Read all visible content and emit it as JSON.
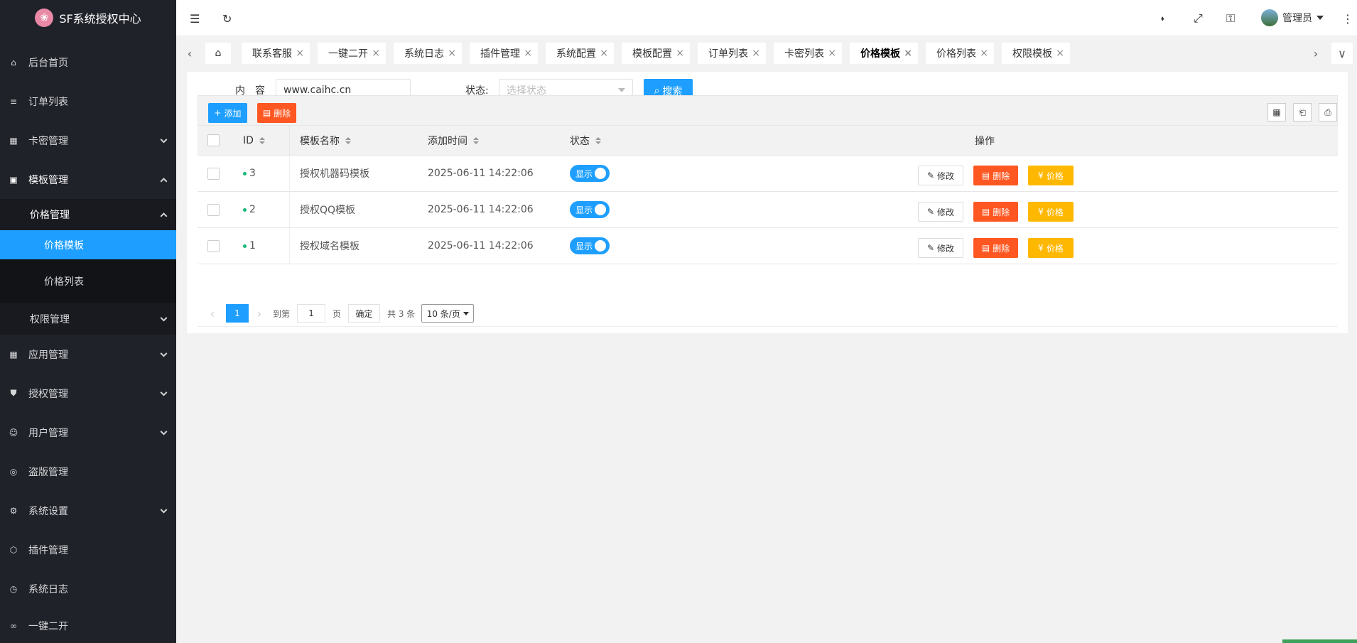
{
  "app": {
    "title": "SF系统授权中心",
    "logo_glyph": "❀"
  },
  "sidebar": {
    "items": [
      {
        "label": "后台首页",
        "icon": "home-icon",
        "glyph": "⌂"
      },
      {
        "label": "订单列表",
        "icon": "document-icon",
        "glyph": "≡"
      },
      {
        "label": "卡密管理",
        "icon": "grid-icon",
        "glyph": "▦"
      },
      {
        "label": "模板管理",
        "icon": "template-icon",
        "glyph": "▣"
      },
      {
        "label": "价格管理"
      },
      {
        "label": "价格模板"
      },
      {
        "label": "价格列表"
      },
      {
        "label": "权限管理"
      },
      {
        "label": "应用管理",
        "icon": "apps-icon",
        "glyph": "▦"
      },
      {
        "label": "授权管理",
        "icon": "shield-icon",
        "glyph": "⛊"
      },
      {
        "label": "用户管理",
        "icon": "user-icon",
        "glyph": "☺"
      },
      {
        "label": "盗版管理",
        "icon": "globe-icon",
        "glyph": "◎"
      },
      {
        "label": "系统设置",
        "icon": "gear-icon",
        "glyph": "⚙"
      },
      {
        "label": "插件管理",
        "icon": "cube-icon",
        "glyph": "⬡"
      },
      {
        "label": "系统日志",
        "icon": "clock-icon",
        "glyph": "◷"
      },
      {
        "label": "一键二开",
        "icon": "link-icon",
        "glyph": "∞"
      }
    ]
  },
  "topbar": {
    "menu_glyph": "☰",
    "refresh_glyph": "↻",
    "tag_glyph": "⬪",
    "fullscreen_glyph": "⤢",
    "lock_glyph": "⚿",
    "user": "管理员",
    "more_glyph": "⋮"
  },
  "tabs": {
    "prev": "‹",
    "next": "›",
    "dropdown": "∨",
    "home_glyph": "⌂",
    "close": "×",
    "items": [
      "联系客服",
      "一键二开",
      "系统日志",
      "插件管理",
      "系统配置",
      "模板配置",
      "订单列表",
      "卡密列表",
      "价格模板",
      "价格列表",
      "权限模板"
    ]
  },
  "search": {
    "content_label": "内　容",
    "content_value": "www.caihc.cn",
    "status_label": "状态:",
    "status_placeholder": "选择状态",
    "search_button": "搜索",
    "search_glyph": "⌕"
  },
  "toolbar": {
    "add_label": "添加",
    "add_glyph": "+",
    "delete_label": "删除",
    "delete_glyph": "▤",
    "columns_glyph": "▦",
    "export_glyph": "⎗",
    "print_glyph": "⎙"
  },
  "table": {
    "headers": {
      "id": "ID",
      "name": "模板名称",
      "time": "添加时间",
      "status": "状态",
      "ops": "操作"
    },
    "rows": [
      {
        "id": "3",
        "name": "授权机器码模板",
        "time": "2025-06-11 14:22:06",
        "status": "显示"
      },
      {
        "id": "2",
        "name": "授权QQ模板",
        "time": "2025-06-11 14:22:06",
        "status": "显示"
      },
      {
        "id": "1",
        "name": "授权域名模板",
        "time": "2025-06-11 14:22:06",
        "status": "显示"
      }
    ],
    "edit_label": "修改",
    "edit_glyph": "✎",
    "del_label": "删除",
    "del_glyph": "▤",
    "price_label": "价格",
    "price_glyph": "¥"
  },
  "pagination": {
    "prev": "‹",
    "current": "1",
    "next": "›",
    "goto_label": "到第",
    "goto_value": "1",
    "page_suffix": "页",
    "confirm": "确定",
    "total": "共 3 条",
    "per_page": "10 条/页"
  }
}
